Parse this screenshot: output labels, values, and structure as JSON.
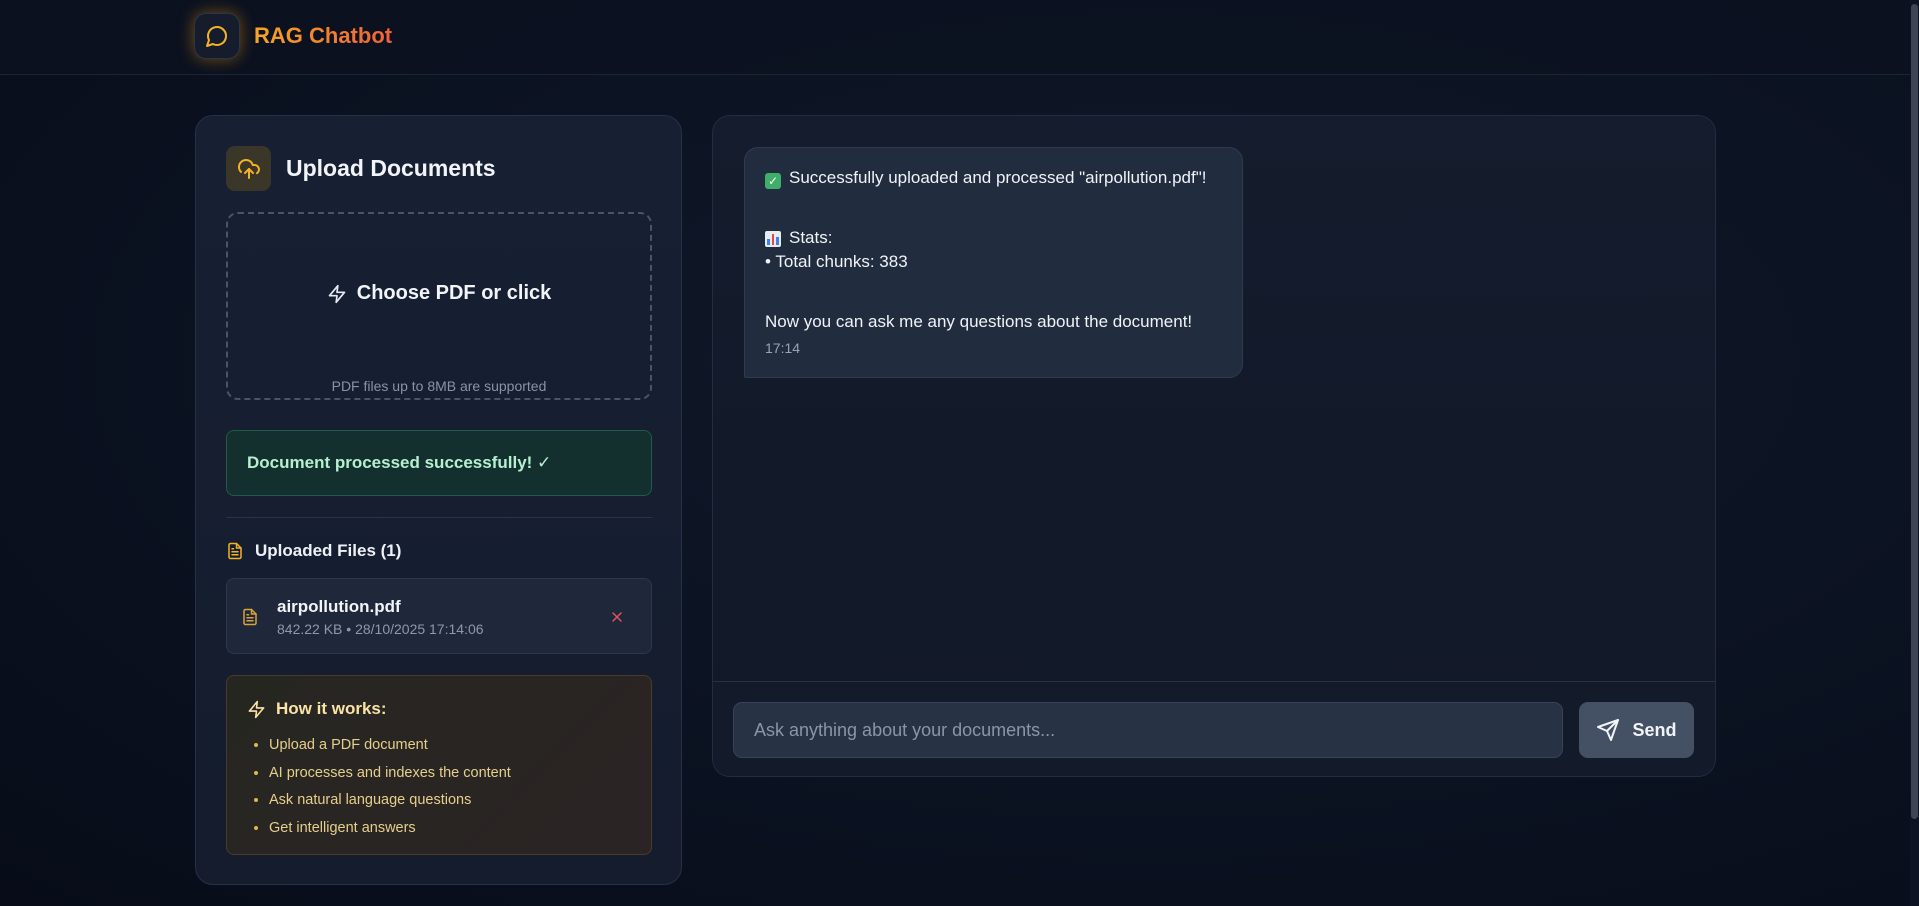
{
  "app": {
    "title": "RAG Chatbot",
    "logo_icon": "chat-bubble-icon"
  },
  "upload": {
    "title": "Upload Documents",
    "icon": "cloud-upload-icon",
    "dropzone_label": "Choose PDF or click",
    "dropzone_icon": "lightning-icon",
    "dropzone_hint": "PDF files up to 8MB are supported",
    "status_message": "Document processed successfully! ✓"
  },
  "files": {
    "heading": "Uploaded Files (1)",
    "items": [
      {
        "name": "airpollution.pdf",
        "meta": "842.22 KB • 28/10/2025 17:14:06",
        "icon": "document-icon",
        "remove_icon": "close-icon"
      }
    ]
  },
  "how_it_works": {
    "title": "How it works:",
    "steps": [
      "Upload a PDF document",
      "AI processes and indexes the content",
      "Ask natural language questions",
      "Get intelligent answers"
    ]
  },
  "chat": {
    "messages": [
      {
        "line1": "Successfully uploaded and processed \"airpollution.pdf\"!",
        "line2": "Stats:",
        "line3": "• Total chunks: 383",
        "line4": "Now you can ask me any questions about the document!",
        "time": "17:14"
      }
    ],
    "input_placeholder": "Ask anything about your documents...",
    "send_label": "Send"
  },
  "colors": {
    "accent": "#f5a623",
    "accent_end": "#f0613a",
    "success_text": "#b6f0d0",
    "danger": "#e0555e",
    "background": "#0b1221"
  }
}
